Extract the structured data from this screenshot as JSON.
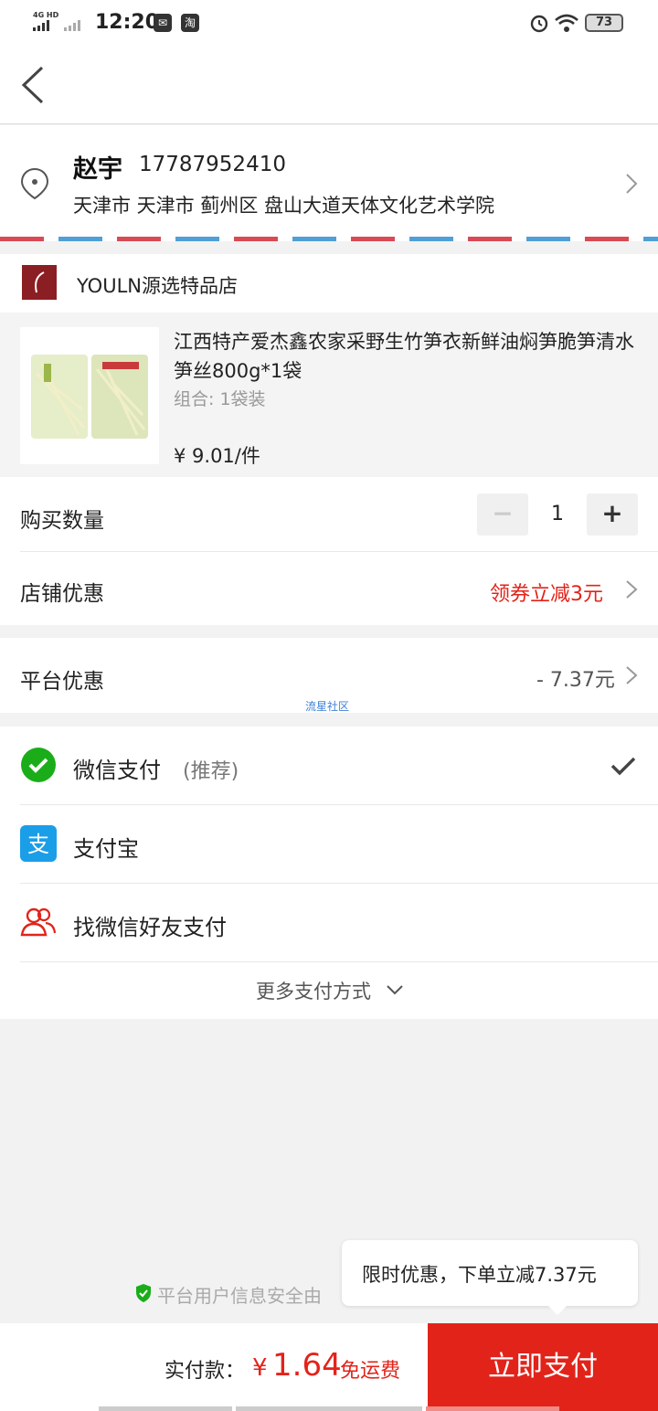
{
  "status_bar": {
    "network": "4G HD",
    "time": "12:20",
    "battery": "73",
    "app_icon_1": "message-icon",
    "app_icon_2": "淘"
  },
  "address": {
    "name": "赵宇",
    "phone": "17787952410",
    "detail": "天津市 天津市 蓟州区 盘山大道天体文化艺术学院"
  },
  "shop": {
    "name": "YOULN源选特品店"
  },
  "product": {
    "title": "江西特产爱杰鑫农家采野生竹笋衣新鲜油焖笋脆笋清水笋丝800g*1袋",
    "spec": "组合: 1袋装",
    "price": "¥ 9.01/件"
  },
  "quantity": {
    "label": "购买数量",
    "minus": "−",
    "value": "1",
    "plus": "+"
  },
  "shop_discount": {
    "label": "店铺优惠",
    "value": "领券立减3元"
  },
  "platform_discount": {
    "label": "平台优惠",
    "value": "- 7.37元",
    "watermark": "流星社区"
  },
  "payment": {
    "methods": [
      {
        "label": "微信支付",
        "note": "(推荐)",
        "icon": "wechat-icon",
        "selected": true
      },
      {
        "label": "支付宝",
        "icon": "alipay-icon",
        "selected": false
      },
      {
        "label": "找微信好友支付",
        "icon": "friends-icon",
        "selected": false
      }
    ],
    "more": "更多支付方式"
  },
  "security_notice": "平台用户信息安全由",
  "tooltip": "限时优惠，下单立减7.37元",
  "bottom": {
    "label": "实付款：",
    "currency": "¥",
    "amount": "1.64",
    "shipping": "免运费",
    "pay_button": "立即支付"
  },
  "colors": {
    "accent": "#e2231a",
    "wechat": "#1aad19",
    "alipay": "#1a9ee8"
  }
}
